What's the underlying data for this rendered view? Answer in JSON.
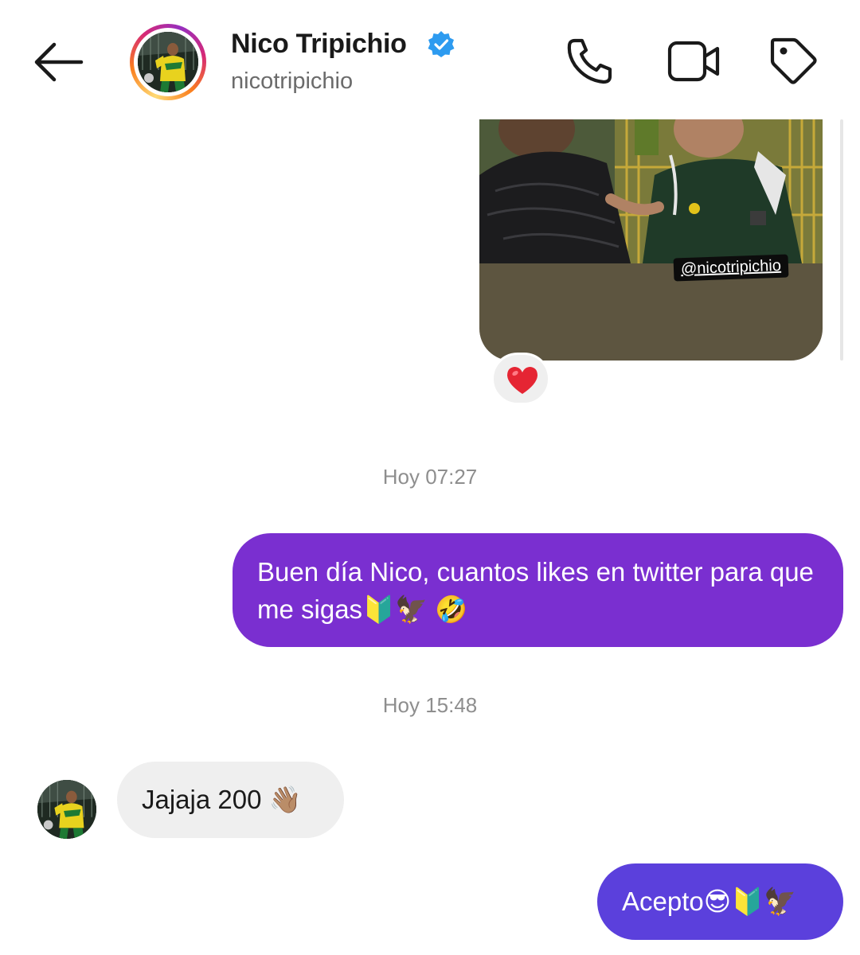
{
  "header": {
    "name": "Nico Tripichio",
    "username": "nicotripichio",
    "icons": [
      "back-arrow-icon",
      "verified-badge-icon",
      "phone-icon",
      "video-camera-icon",
      "tag-icon"
    ]
  },
  "shared_post": {
    "photo_tag": "@nicotripichio",
    "reaction": "❤️"
  },
  "messages": [
    {
      "timestamp": "Hoy 07:27",
      "direction": "outgoing",
      "text": "Buen día Nico, cuantos likes en twitter para que me sigas🔰🦅 🤣"
    },
    {
      "timestamp": "Hoy 15:48",
      "direction": "incoming",
      "text": "Jajaja 200 👋🏽"
    },
    {
      "direction": "outgoing",
      "text": "Acepto😎🔰🦅"
    }
  ],
  "colors": {
    "outgoing_bubble_1": "#7a2fd0",
    "outgoing_bubble_2": "#5b40dc",
    "incoming_bubble": "#efefef",
    "verified_badge": "#2d9bf0",
    "timestamp_text": "#8e8e8e",
    "post_background": "#5d5540"
  }
}
